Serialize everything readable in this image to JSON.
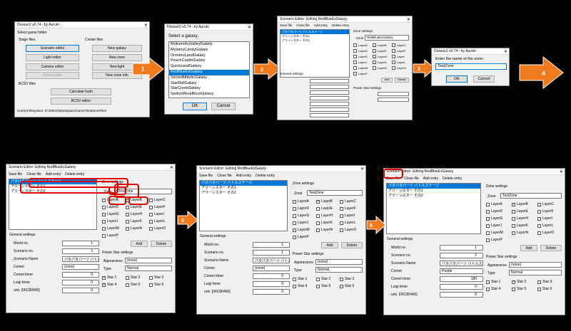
{
  "w1": {
    "title": "Dossun2 v0.74 - by Aurum",
    "select_game_folder": "Select game folder",
    "stage_files": "Stage files",
    "create_files": "Create files",
    "scenario_editor": "Scenario editor",
    "light_editor": "Light editor",
    "camera_editor": "Camera editor",
    "zones_editor": "Zones editor",
    "new_galaxy": "New galaxy",
    "new_zone": "New zone",
    "new_light": "New light",
    "new_zone_info": "New zone info",
    "bcsv_files": "BCSV files",
    "calculate_hash": "Calculate hash",
    "bcsv_editor": "BCSV editor",
    "current_filesystem": "Current filesystem: D:\\SMG2\\Workspace\\Game\\TestZone\\Files"
  },
  "w2": {
    "title": "Dossun2 v0.74 - by Aurum",
    "prompt": "Select a galaxy.",
    "items": [
      "MokumokuValleyGalaxy",
      "MysteryCandyGalaxy",
      "OmoteuLandGalaxy",
      "PeachCastleGalaxy",
      "QuicksandGalaxy",
      "RedBlueExGalaxy",
      "SecretAthleticGalaxy",
      "StarRollGalaxy",
      "StarCreekGalaxy",
      "SwitchMoveBlockGalaxy"
    ],
    "ok": "OK",
    "cancel": "Cancel"
  },
  "w3": {
    "title": "Scenario Editor: Editing RedBlueExGalaxy",
    "menu": [
      "Save file",
      "Close file",
      "Add entry",
      "Delete entry"
    ],
    "zone_settings": "Zone settings",
    "zone_label": "Zone",
    "zone_value": "RedBlueExGalaxy",
    "scenarios": [
      "パタパタパーツ  バトルステージ",
      "アリーンスター  その1",
      "アリーンスター  その2"
    ],
    "layers": [
      "LayerA",
      "LayerB",
      "LayerC",
      "LayerD",
      "LayerE",
      "LayerF",
      "LayerG",
      "LayerH",
      "LayerI",
      "LayerJ",
      "LayerK",
      "LayerL",
      "LayerM",
      "LayerN",
      "LayerO",
      "LayerP"
    ],
    "add": "Add",
    "delete": "Delete",
    "general_settings": "General settings",
    "power_star_settings": "Power Star settings"
  },
  "w4": {
    "title": "Dossun2 v0.74 - by Aurum",
    "prompt": "Enter the name of the zone:",
    "value": "TestZone",
    "ok": "OK",
    "cancel": "Cancel"
  },
  "big": {
    "title": "Scenario Editor: Editing RedBlueExGalaxy",
    "menu": [
      "Save file",
      "Close file",
      "Add entry",
      "Delete entry"
    ],
    "zone_settings": "Zone settings",
    "zone_label": "Zone",
    "zone_value": "TestZone",
    "scenarios": [
      "パタパタパーツ  バトルステージ",
      "アリーンスター  その1",
      "アリーンスター  その2"
    ],
    "layers": [
      "LayerA",
      "LayerB",
      "LayerC",
      "LayerD",
      "LayerE",
      "LayerF",
      "LayerG",
      "LayerH",
      "LayerI",
      "LayerJ",
      "LayerK",
      "LayerL",
      "LayerM",
      "LayerN",
      "LayerO",
      "LayerP"
    ],
    "add": "Add",
    "delete": "Delete",
    "general_settings": "General settings",
    "world_no": "World no.",
    "world_no_val": "1",
    "scenario_no": "Scenario no.",
    "scenario_no_val": "1",
    "scenario_name": "Scenario Name",
    "scenario_name_val": "パタパタパーツ  バトルステージ",
    "comet": "Comet",
    "comet_val": "(none)",
    "comet_val_3": "Purple",
    "comet_timer": "Comet timer",
    "comet_timer_val": "0",
    "comet_timer_val_3": "180",
    "luigi_timer": "Luigi timer",
    "luigi_timer_val": "0",
    "unk": "unk. [06C80460]",
    "unk_val": "0",
    "power_star_settings": "Power Star settings",
    "appearance": "Appearance",
    "appearance_val": "(none)",
    "type": "Type",
    "type_val": "Normal",
    "stars": [
      "Star 1",
      "Star 2",
      "Star 3",
      "Star 4",
      "Star 5",
      "Star 6"
    ]
  },
  "arrows": [
    "1",
    "2",
    "3",
    "4",
    "5",
    "6"
  ],
  "colors": {
    "accent": "#0078d7",
    "arrow": "#f07a1e",
    "highlight": "#e00000"
  }
}
